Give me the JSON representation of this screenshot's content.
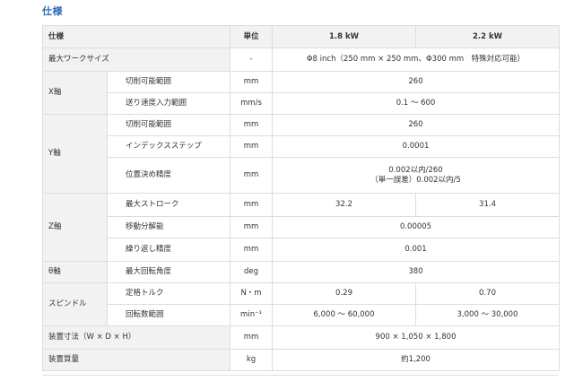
{
  "section_title": "仕様",
  "header": {
    "item": "仕様",
    "unit": "単位",
    "col1": "1.8 kW",
    "col2": "2.2 kW"
  },
  "rows": {
    "max_work": {
      "label": "最大ワークサイズ",
      "unit": "-",
      "value": "Φ8 inch（250 mm × 250 mm、Φ300 mm　特殊対応可能）"
    },
    "x_axis": {
      "label": "X軸",
      "cut_range": {
        "label": "切削可能範囲",
        "unit": "mm",
        "value": "260"
      },
      "feed_range": {
        "label": "送り速度入力範囲",
        "unit": "mm/s",
        "value": "0.1 ～ 600"
      }
    },
    "y_axis": {
      "label": "Y軸",
      "cut_range": {
        "label": "切削可能範囲",
        "unit": "mm",
        "value": "260"
      },
      "index_step": {
        "label": "インデックスステップ",
        "unit": "mm",
        "value": "0.0001"
      },
      "position_accuracy": {
        "label": "位置決め精度",
        "unit": "mm",
        "value_line1": "0.002以内/260",
        "value_line2": "（単一誤差）0.002以内/5"
      }
    },
    "z_axis": {
      "label": "Z軸",
      "max_stroke": {
        "label": "最大ストローク",
        "unit": "mm",
        "value_1": "32.2",
        "value_2": "31.4"
      },
      "resolution": {
        "label": "移動分解能",
        "unit": "mm",
        "value": "0.00005"
      },
      "repeatability": {
        "label": "繰り返し精度",
        "unit": "mm",
        "value": "0.001"
      }
    },
    "theta_axis": {
      "label": "θ軸",
      "max_rotation": {
        "label": "最大回転角度",
        "unit": "deg",
        "value": "380"
      }
    },
    "spindle": {
      "label": "スピンドル",
      "rated_torque": {
        "label": "定格トルク",
        "unit": "N・m",
        "value_1": "0.29",
        "value_2": "0.70"
      },
      "speed_range": {
        "label": "回転数範囲",
        "unit": "min⁻¹",
        "value_1": "6,000 ～ 60,000",
        "value_2": "3,000 ～ 30,000"
      }
    },
    "dimensions": {
      "label": "装置寸法（W × D × H）",
      "unit": "mm",
      "value": "900 × 1,050 × 1,800"
    },
    "weight": {
      "label": "装置質量",
      "unit": "kg",
      "value": "約1,200"
    }
  }
}
